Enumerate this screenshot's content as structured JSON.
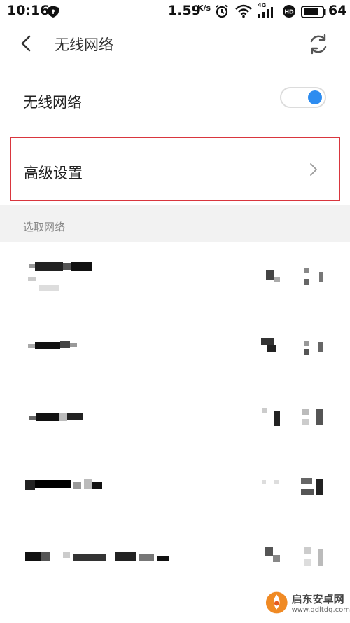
{
  "status_bar": {
    "time": "10:16",
    "net_speed": "1.59",
    "net_speed_unit": "K/s",
    "network_type": "4G",
    "battery_percent": "64"
  },
  "header": {
    "title": "无线网络"
  },
  "wifi_toggle_row": {
    "label": "无线网络",
    "enabled": true
  },
  "advanced_row": {
    "label": "高级设置"
  },
  "network_section": {
    "label": "选取网络",
    "networks": [
      {
        "name": "",
        "signal_icon": "wifi-signal-icon"
      },
      {
        "name": "",
        "signal_icon": "wifi-signal-icon"
      },
      {
        "name": "",
        "signal_icon": "wifi-signal-icon"
      },
      {
        "name": "",
        "signal_icon": "wifi-signal-icon"
      },
      {
        "name": "",
        "signal_icon": "wifi-signal-icon"
      }
    ]
  },
  "watermark": {
    "name": "启东安卓网",
    "url": "www.qdltdq.com"
  },
  "colors": {
    "accent": "#2d8cf0",
    "highlight_border": "#d9363e",
    "section_bg": "#f2f2f2"
  }
}
